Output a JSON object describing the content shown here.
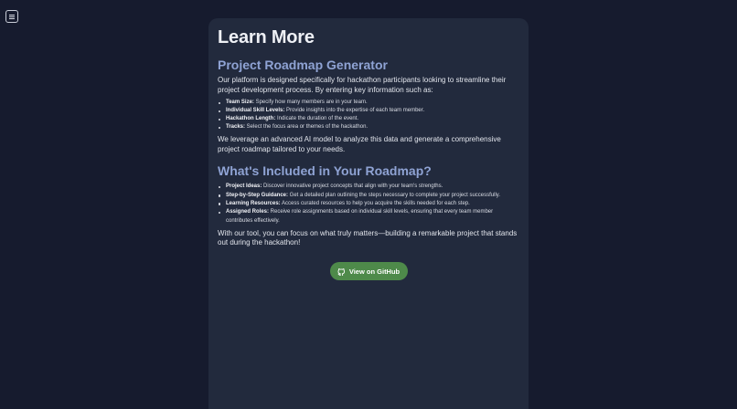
{
  "menu": {
    "icon": "hamburger-menu-icon"
  },
  "content": {
    "title": "Learn More",
    "section1": {
      "heading": "Project Roadmap Generator",
      "intro": "Our platform is designed specifically for hackathon participants looking to streamline their project development process. By entering key information such as:",
      "items": [
        {
          "label": "Team Size:",
          "text": " Specify how many members are in your team."
        },
        {
          "label": "Individual Skill Levels:",
          "text": " Provide insights into the expertise of each team member."
        },
        {
          "label": "Hackathon Length:",
          "text": " Indicate the duration of the event."
        },
        {
          "label": "Tracks:",
          "text": " Select the focus area or themes of the hackathon."
        }
      ],
      "outro": "We leverage an advanced AI model to analyze this data and generate a comprehensive project roadmap tailored to your needs."
    },
    "section2": {
      "heading": "What's Included in Your Roadmap?",
      "items": [
        {
          "label": "Project Ideas:",
          "text": " Discover innovative project concepts that align with your team's strengths."
        },
        {
          "label": "Step-by-Step Guidance:",
          "text": " Get a detailed plan outlining the steps necessary to complete your project successfully."
        },
        {
          "label": "Learning Resources:",
          "text": " Access curated resources to help you acquire the skills needed for each step."
        },
        {
          "label": "Assigned Roles:",
          "text": " Receive role assignments based on individual skill levels, ensuring that every team member contributes effectively."
        }
      ],
      "outro": "With our tool, you can focus on what truly matters—building a remarkable project that stands out during the hackathon!"
    },
    "github_button": {
      "label": "View on GitHub",
      "icon": "github-icon",
      "color": "#4e8a4a"
    }
  },
  "colors": {
    "background": "#161b2e",
    "card": "#222a3d",
    "heading_accent": "#8fa3d4"
  }
}
